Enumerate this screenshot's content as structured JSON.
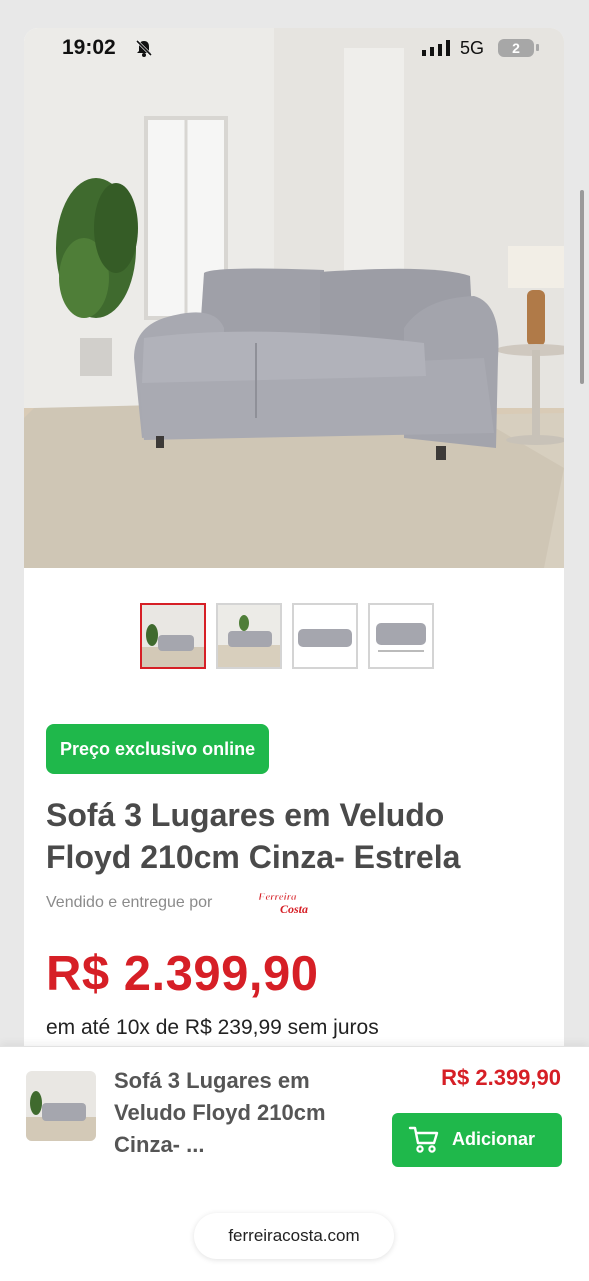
{
  "status": {
    "time": "19:02",
    "network": "5G",
    "battery": "2"
  },
  "product": {
    "badge": "Preço exclusivo online",
    "title": "Sofá 3 Lugares em Veludo Floyd 210cm Cinza- Estrela",
    "seller_label": "Vendido e entregue por",
    "seller_logo_text": "Ferreira Costa",
    "price": "R$ 2.399,90",
    "installments": "em até 10x de R$ 239,99 sem juros"
  },
  "bottom_bar": {
    "title": "Sofá 3 Lugares em Veludo Floyd 210cm Cinza- ...",
    "price": "R$ 2.399,90",
    "add_label": "Adicionar"
  },
  "browser": {
    "url": "ferreiracosta.com"
  },
  "colors": {
    "brand_red": "#d61f26",
    "accent_green": "#1fb84b",
    "sofa_gray": "#a5a6ae"
  },
  "icons": [
    "bell-slash-icon",
    "signal-icon",
    "battery-icon",
    "cart-icon"
  ]
}
